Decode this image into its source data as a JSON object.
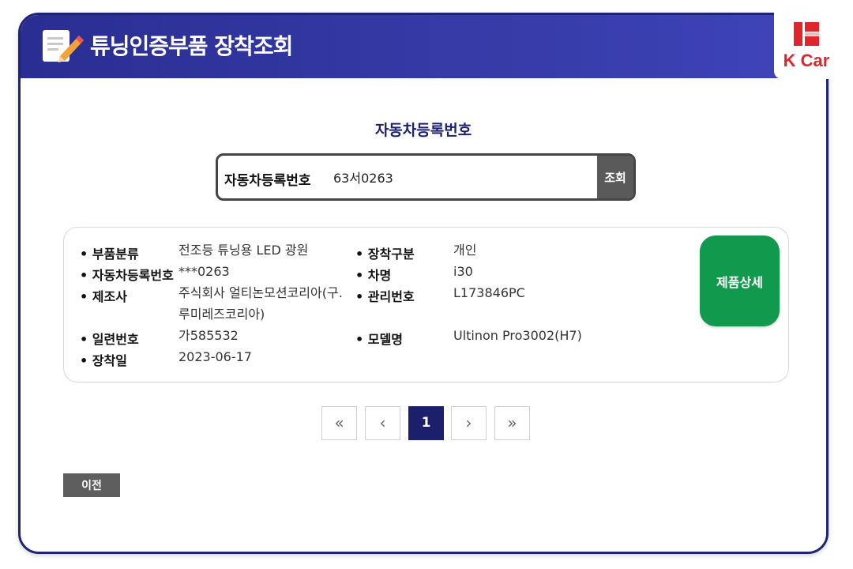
{
  "header": {
    "title": "튜닝인증부품 장착조회",
    "logo_text": "K Car",
    "color": "#2e3398"
  },
  "search": {
    "section_title": "자동차등록번호",
    "field_label": "자동차등록번호",
    "value": "63서0263",
    "button_label": "조회"
  },
  "result": {
    "left": [
      {
        "label": "부품분류",
        "value": "전조등 튜닝용 LED 광원"
      },
      {
        "label": "자동차등록번호",
        "value": "***0263"
      },
      {
        "label": "제조사",
        "value_line1": "주식회사 얼티논모션코리아(구.",
        "value_line2": "루미레즈코리아)"
      },
      {
        "label": "일련번호",
        "value": "가585532"
      },
      {
        "label": "장착일",
        "value": "2023-06-17"
      }
    ],
    "right": [
      {
        "label": "장착구분",
        "value": "개인"
      },
      {
        "label": "차명",
        "value": "i30"
      },
      {
        "label": "관리번호",
        "value": "L173846PC"
      },
      {
        "label": "모델명",
        "value": "Ultinon Pro3002(H7)"
      }
    ],
    "detail_button": "제품상세"
  },
  "pagination": {
    "first": "«",
    "prev": "‹",
    "current": "1",
    "next": "›",
    "last": "»"
  },
  "footer": {
    "prev_button": "이전"
  },
  "colors": {
    "accent": "#1c1f6b",
    "detail_green": "#11994d",
    "brand_red": "#e0262c"
  }
}
